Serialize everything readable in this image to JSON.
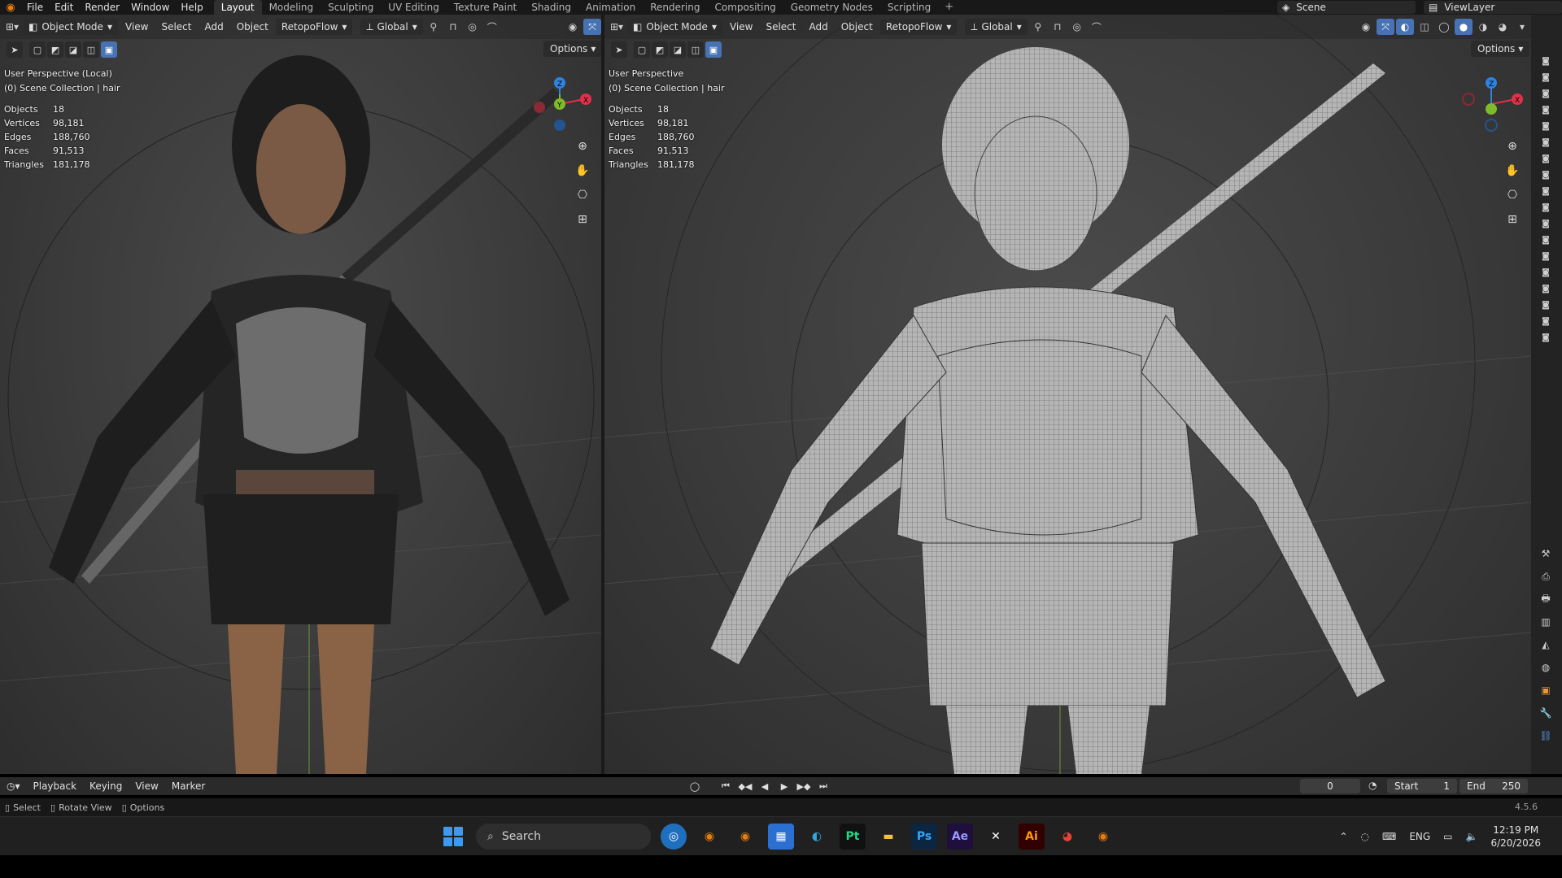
{
  "topbar": {
    "menus": [
      "File",
      "Edit",
      "Render",
      "Window",
      "Help"
    ],
    "workspaces": [
      "Layout",
      "Modeling",
      "Sculpting",
      "UV Editing",
      "Texture Paint",
      "Shading",
      "Animation",
      "Rendering",
      "Compositing",
      "Geometry Nodes",
      "Scripting"
    ],
    "active_workspace": "Layout",
    "scene": "Scene",
    "view_layer": "ViewLayer"
  },
  "left_viewport": {
    "mode": "Object Mode",
    "menus": [
      "View",
      "Select",
      "Add",
      "Object"
    ],
    "addon": "RetopoFlow",
    "orientation": "Global",
    "options": "Options",
    "perspective": "User Perspective (Local)",
    "collection": "(0) Scene Collection | hair",
    "stats": [
      {
        "label": "Objects",
        "value": "18"
      },
      {
        "label": "Vertices",
        "value": "98,181"
      },
      {
        "label": "Edges",
        "value": "188,760"
      },
      {
        "label": "Faces",
        "value": "91,513"
      },
      {
        "label": "Triangles",
        "value": "181,178"
      }
    ]
  },
  "right_viewport": {
    "mode": "Object Mode",
    "menus": [
      "View",
      "Select",
      "Add",
      "Object"
    ],
    "addon": "RetopoFlow",
    "orientation": "Global",
    "options": "Options",
    "perspective": "User Perspective",
    "collection": "(0) Scene Collection | hair",
    "stats": [
      {
        "label": "Objects",
        "value": "18"
      },
      {
        "label": "Vertices",
        "value": "98,181"
      },
      {
        "label": "Edges",
        "value": "188,760"
      },
      {
        "label": "Faces",
        "value": "91,513"
      },
      {
        "label": "Triangles",
        "value": "181,178"
      }
    ]
  },
  "timeline": {
    "menus": [
      "Playback",
      "Keying",
      "View",
      "Marker"
    ],
    "current_frame": "0",
    "start_label": "Start",
    "start_value": "1",
    "end_label": "End",
    "end_value": "250"
  },
  "statusbar": {
    "items": [
      "Select",
      "Rotate View",
      "Options"
    ],
    "version": "4.5.6"
  },
  "taskbar": {
    "search_placeholder": "Search",
    "apps": [
      {
        "icon": "edge-feedback-icon",
        "label": ""
      },
      {
        "icon": "blender-icon",
        "label": ""
      },
      {
        "icon": "blender-icon",
        "label": ""
      },
      {
        "icon": "store-icon",
        "label": ""
      },
      {
        "icon": "edge-icon",
        "label": ""
      },
      {
        "icon": "pycharm-icon",
        "label": "Pt"
      },
      {
        "icon": "folder-icon",
        "label": ""
      },
      {
        "icon": "photoshop-icon",
        "label": "Ps"
      },
      {
        "icon": "after-effects-icon",
        "label": "Ae"
      },
      {
        "icon": "inkscape-icon",
        "label": ""
      },
      {
        "icon": "illustrator-icon",
        "label": "Ai"
      },
      {
        "icon": "chrome-icon",
        "label": ""
      },
      {
        "icon": "blender-icon",
        "label": ""
      }
    ],
    "language": "ENG",
    "time": "12:19 PM",
    "date": "6/20/2026"
  },
  "colors": {
    "accent": "#4772b3",
    "blender_orange": "#e87d0d",
    "axis_x": "#e0304a",
    "axis_y": "#7fba2a",
    "axis_z": "#2f82e0"
  }
}
